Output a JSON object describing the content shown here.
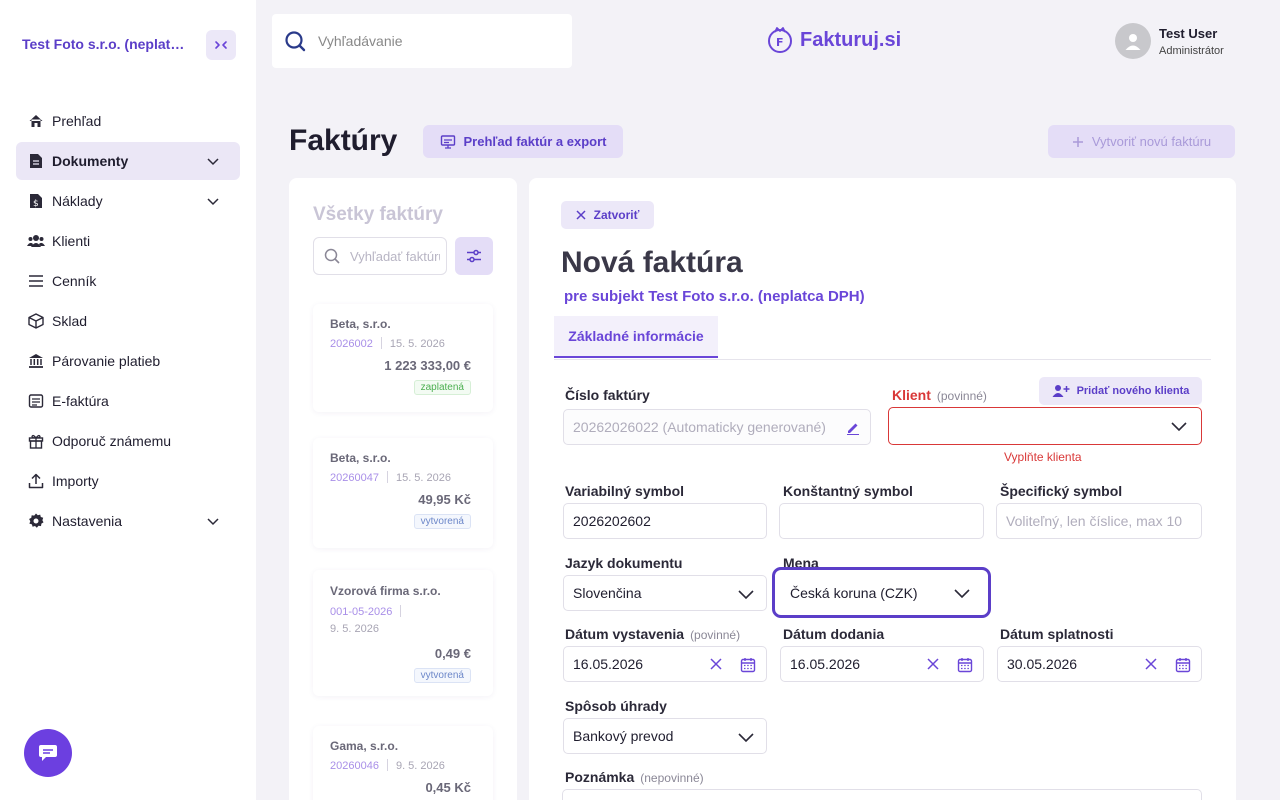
{
  "sidebar": {
    "company": "Test Foto s.r.o. (neplatca DPH)",
    "items": [
      {
        "label": "Prehľad",
        "icon": "home-icon"
      },
      {
        "label": "Dokumenty",
        "icon": "document-icon"
      },
      {
        "label": "Náklady",
        "icon": "receipt-icon"
      },
      {
        "label": "Klienti",
        "icon": "users-icon"
      },
      {
        "label": "Cenník",
        "icon": "list-icon"
      },
      {
        "label": "Sklad",
        "icon": "box-icon"
      },
      {
        "label": "Párovanie platieb",
        "icon": "bank-icon"
      },
      {
        "label": "E-faktúra",
        "icon": "einvoice-icon"
      },
      {
        "label": "Odporuč známemu",
        "icon": "gift-icon"
      },
      {
        "label": "Importy",
        "icon": "upload-icon"
      },
      {
        "label": "Nastavenia",
        "icon": "gear-icon"
      }
    ]
  },
  "header": {
    "search_placeholder": "Vyhľadávanie",
    "logo": "Fakturuj.si",
    "user_name": "Test User",
    "user_role": "Administrátor"
  },
  "page": {
    "title": "Faktúry",
    "overview_button": "Prehľad faktúr a export",
    "create_button": "Vytvoriť novú faktúru"
  },
  "list": {
    "title": "Všetky faktúry",
    "search_placeholder": "Vyhľadať faktúru",
    "invoices": [
      {
        "client": "Beta, s.r.o.",
        "number": "2026002",
        "date": "15. 5. 2026",
        "amount": "1 223 333,00 €",
        "status": "zaplatená"
      },
      {
        "client": "Beta, s.r.o.",
        "number": "20260047",
        "date": "15. 5. 2026",
        "amount": "49,95 Kč",
        "status": "vytvorená"
      },
      {
        "client": "Vzorová firma s.r.o.",
        "number": "001-05-2026",
        "date": "9. 5. 2026",
        "amount": "0,49 €",
        "status": "vytvorená"
      },
      {
        "client": "Gama, s.r.o.",
        "number": "20260046",
        "date": "9. 5. 2026",
        "amount": "0,45 Kč",
        "status": ""
      }
    ]
  },
  "form": {
    "close_label": "Zatvoriť",
    "title": "Nová faktúra",
    "subtitle": "pre subjekt Test Foto s.r.o. (neplatca DPH)",
    "tab": "Základné informácie",
    "invoice_number_label": "Číslo faktúry",
    "invoice_number_value": "20262026022 (Automaticky generované)",
    "client_label": "Klient",
    "required_text": "(povinné)",
    "optional_text": "(nepovinné)",
    "add_client_label": "Pridať nového klienta",
    "client_error": "Vyplňte klienta",
    "variable_symbol_label": "Variabilný symbol",
    "variable_symbol_value": "2026202602",
    "constant_symbol_label": "Konštantný symbol",
    "constant_symbol_value": "",
    "specific_symbol_label": "Špecifický symbol",
    "specific_symbol_placeholder": "Voliteľný, len číslice, max 10",
    "language_label": "Jazyk dokumentu",
    "language_value": "Slovenčina",
    "currency_label": "Mena",
    "currency_value": "Česká koruna (CZK)",
    "issue_date_label": "Dátum vystavenia",
    "issue_date_value": "16.05.2026",
    "delivery_date_label": "Dátum dodania",
    "delivery_date_value": "16.05.2026",
    "due_date_label": "Dátum splatnosti",
    "due_date_value": "30.05.2026",
    "payment_method_label": "Spôsob úhrady",
    "payment_method_value": "Bankový prevod",
    "note_label": "Poznámka"
  },
  "colors": {
    "accent": "#6a46d8",
    "accent_light": "#e4ddf7",
    "error": "#d93838",
    "background": "#f3f2f7"
  }
}
